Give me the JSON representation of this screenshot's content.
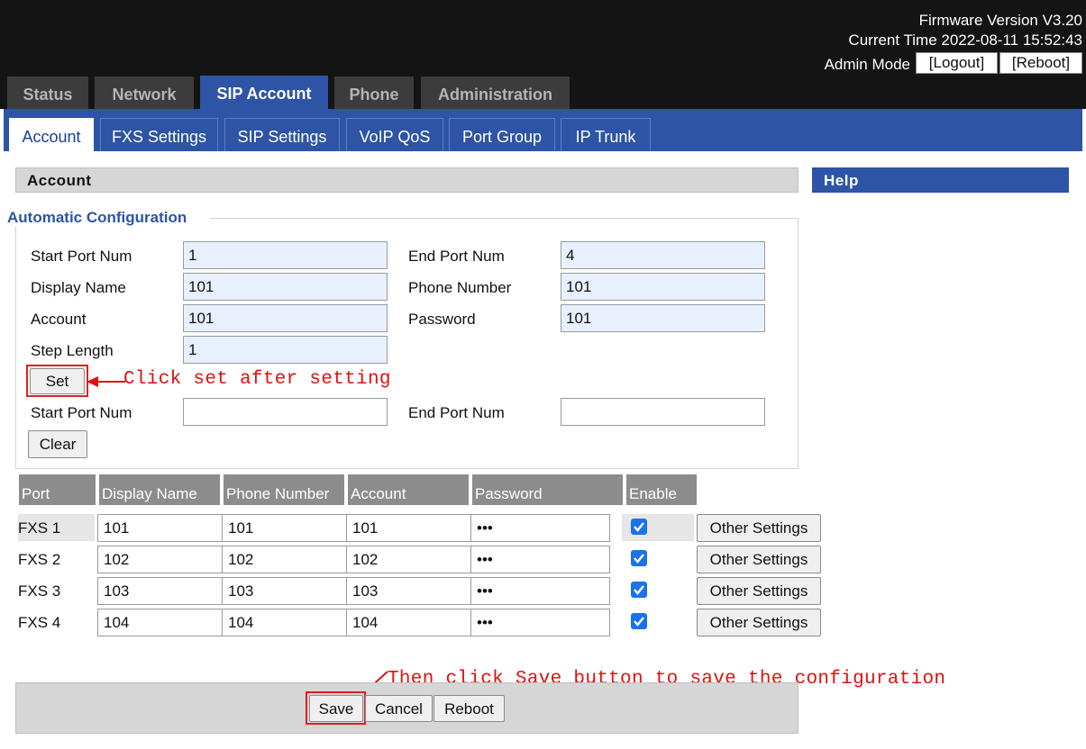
{
  "header": {
    "firmware": "Firmware Version V3.20",
    "current_time": "Current Time 2022-08-11 15:52:43",
    "admin_mode": "Admin Mode",
    "logout": "[Logout]",
    "reboot": "[Reboot]"
  },
  "main_tabs": [
    "Status",
    "Network",
    "SIP Account",
    "Phone",
    "Administration"
  ],
  "active_main_tab": "SIP Account",
  "sub_tabs": [
    "Account",
    "FXS Settings",
    "SIP Settings",
    "VoIP QoS",
    "Port Group",
    "IP Trunk"
  ],
  "active_sub_tab": "Account",
  "section": {
    "title": "Account",
    "help": "Help"
  },
  "auto_config": {
    "legend": "Automatic Configuration",
    "start_port_label": "Start Port Num",
    "start_port_value": "1",
    "end_port_label": "End Port Num",
    "end_port_value": "4",
    "display_name_label": "Display Name",
    "display_name_value": "101",
    "phone_number_label": "Phone Number",
    "phone_number_value": "101",
    "account_label": "Account",
    "account_value": "101",
    "password_label": "Password",
    "password_value": "101",
    "step_length_label": "Step Length",
    "step_length_value": "1",
    "set_button": "Set",
    "clear_start_label": "Start Port Num",
    "clear_start_value": "",
    "clear_end_label": "End Port Num",
    "clear_end_value": "",
    "clear_button": "Clear"
  },
  "table": {
    "headers": [
      "Port",
      "Display Name",
      "Phone Number",
      "Account",
      "Password",
      "Enable"
    ],
    "rows": [
      {
        "port": "FXS 1",
        "display_name": "101",
        "phone_number": "101",
        "account": "101",
        "password": "•••",
        "enabled": true,
        "other": "Other Settings"
      },
      {
        "port": "FXS 2",
        "display_name": "102",
        "phone_number": "102",
        "account": "102",
        "password": "•••",
        "enabled": true,
        "other": "Other Settings"
      },
      {
        "port": "FXS 3",
        "display_name": "103",
        "phone_number": "103",
        "account": "103",
        "password": "•••",
        "enabled": true,
        "other": "Other Settings"
      },
      {
        "port": "FXS 4",
        "display_name": "104",
        "phone_number": "104",
        "account": "104",
        "password": "•••",
        "enabled": true,
        "other": "Other Settings"
      }
    ]
  },
  "bottom": {
    "save": "Save",
    "cancel": "Cancel",
    "reboot": "Reboot"
  },
  "annotations": {
    "set_note": "Click set after setting",
    "save_note": "Then click Save button to save the configuration"
  },
  "colors": {
    "accent": "#2d54a5",
    "annotation": "#e01010",
    "header_bg": "#141414",
    "checkbox": "#1a73e8"
  }
}
